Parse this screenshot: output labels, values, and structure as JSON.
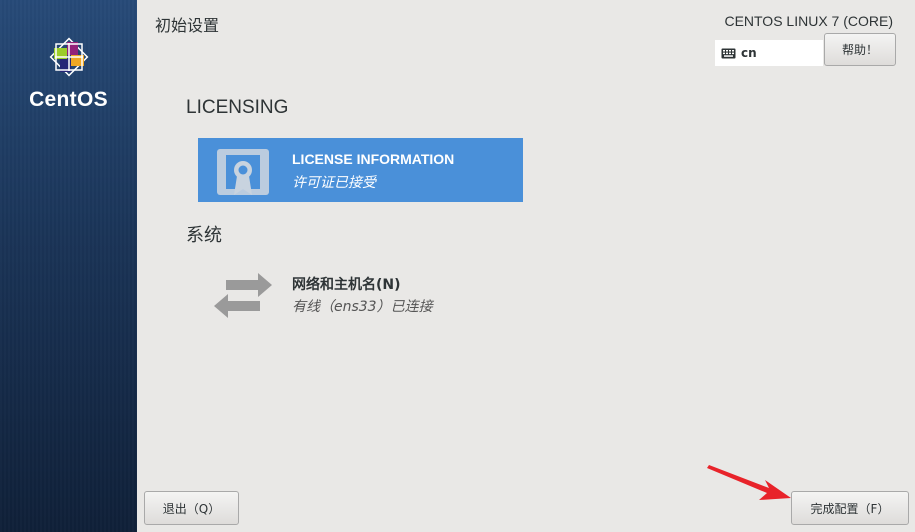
{
  "sidebar": {
    "logo_text": "CentOS"
  },
  "header": {
    "title": "初始设置",
    "distro": "CENTOS LINUX 7 (CORE)",
    "keyboard_layout": "cn",
    "help_label": "帮助！"
  },
  "categories": [
    {
      "title": "LICENSING",
      "spokes": [
        {
          "name": "LICENSE INFORMATION",
          "status": "许可证已接受",
          "selected": true,
          "icon": "license-icon"
        }
      ]
    },
    {
      "title": "系统",
      "spokes": [
        {
          "name": "网络和主机名(N)",
          "status": "有线（ens33）已连接",
          "selected": false,
          "icon": "network-arrows-icon"
        }
      ]
    }
  ],
  "buttons": {
    "quit": "退出（Q）",
    "finish": "完成配置（F）"
  },
  "colors": {
    "selected_spoke": "#4a90d9",
    "sidebar": "#1a3457",
    "annotation_arrow": "#e8232a"
  }
}
